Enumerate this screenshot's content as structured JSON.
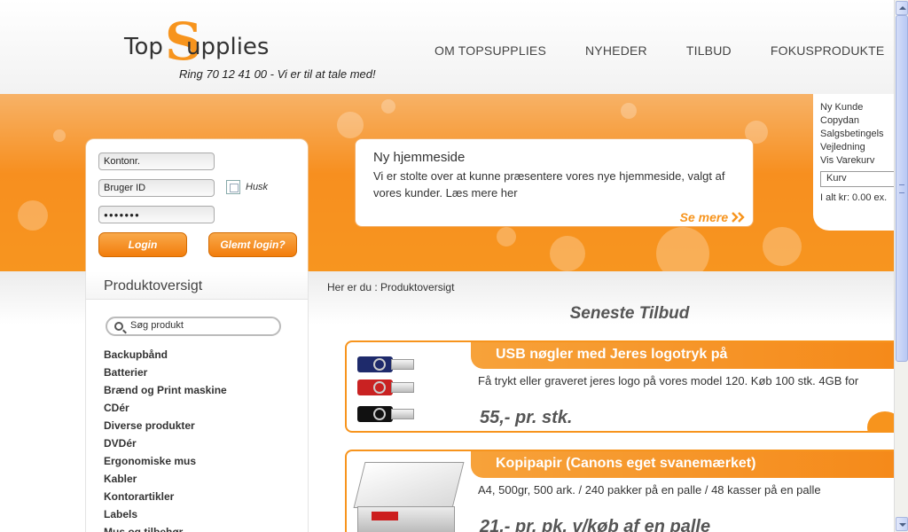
{
  "brand": {
    "logo_top": "Top",
    "logo_s": "S",
    "logo_rest": "upplies",
    "tagline": "Ring 70 12 41 00 - Vi er til at tale med!",
    "accent": "#f7941d"
  },
  "topnav": [
    "OM TOPSUPPLIES",
    "NYHEDER",
    "TILBUD",
    "FOKUSPRODUKTE"
  ],
  "rightpanel": {
    "links": [
      "Ny Kunde",
      "Copydan",
      "Salgsbetingels",
      "Vejledning",
      "Vis Varekurv"
    ],
    "kurv_select": "Kurv",
    "total": "I alt kr: 0.00 ex."
  },
  "login": {
    "kontonr": "Kontonr.",
    "bruger_id": "Bruger ID",
    "password_mask": "●●●●●●●",
    "husk_label": "Husk",
    "login_btn": "Login",
    "glemt_btn": "Glemt login?"
  },
  "news": {
    "title": "Ny hjemmeside",
    "text": "Vi er stolte over at kunne præsentere vores nye hjemmeside, valgt af vores kunder. Læs mere her",
    "link": "Se mere"
  },
  "sidebar": {
    "title": "Produktoversigt",
    "search_placeholder": "Søg produkt",
    "categories": [
      "Backupbånd",
      "Batterier",
      "Brænd og Print maskine",
      "CDér",
      "Diverse produkter",
      "DVDér",
      "Ergonomiske mus",
      "Kabler",
      "Kontorartikler",
      "Labels",
      "Mus og tilbehør"
    ]
  },
  "breadcrumb": "Her er du : Produktoversigt",
  "section_title": "Seneste Tilbud",
  "offers": [
    {
      "title": "USB nøgler med Jeres logotryk på",
      "desc": "Få trykt eller graveret jeres logo på vores model 120. Køb 100 stk. 4GB for",
      "price": "55,- pr. stk."
    },
    {
      "title": "Kopipapir (Canons eget svanemærket)",
      "desc": "A4, 500gr, 500 ark. / 240 pakker på en palle / 48 kasser på en palle",
      "price": "21,- pr. pk. v/køb af en palle"
    }
  ]
}
